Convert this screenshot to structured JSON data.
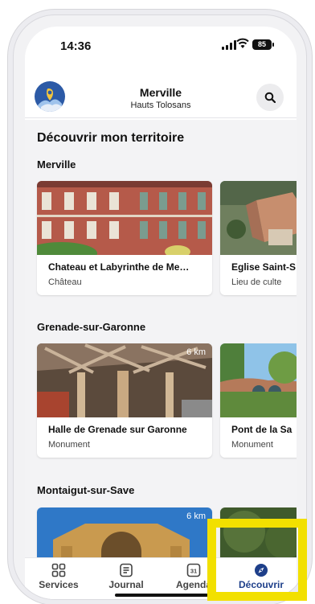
{
  "status_bar": {
    "time": "14:36",
    "battery": "85"
  },
  "header": {
    "title": "Merville",
    "subtitle": "Hauts Tolosans"
  },
  "page": {
    "title": "Découvrir mon territoire"
  },
  "sections": [
    {
      "title": "Merville",
      "cards": [
        {
          "name": "Chateau et Labyrinthe de Me…",
          "category": "Château",
          "distance": ""
        },
        {
          "name": "Eglise Saint-S",
          "category": "Lieu de culte",
          "distance": ""
        }
      ]
    },
    {
      "title": "Grenade-sur-Garonne",
      "cards": [
        {
          "name": "Halle de Grenade sur Garonne",
          "category": "Monument",
          "distance": "6 km"
        },
        {
          "name": "Pont de la Sa",
          "category": "Monument",
          "distance": ""
        }
      ]
    },
    {
      "title": "Montaigut-sur-Save",
      "cards": [
        {
          "name": "",
          "category": "",
          "distance": "6 km"
        },
        {
          "name": "",
          "category": "",
          "distance": ""
        }
      ]
    }
  ],
  "tabs": [
    {
      "label": "Services",
      "icon": "grid-icon",
      "active": false
    },
    {
      "label": "Journal",
      "icon": "journal-icon",
      "active": false
    },
    {
      "label": "Agenda",
      "icon": "calendar-icon",
      "active": false,
      "badge": "31"
    },
    {
      "label": "Découvrir",
      "icon": "compass-icon",
      "active": true
    }
  ],
  "colors": {
    "accent": "#1e3f8a",
    "highlight": "#f2e000"
  }
}
